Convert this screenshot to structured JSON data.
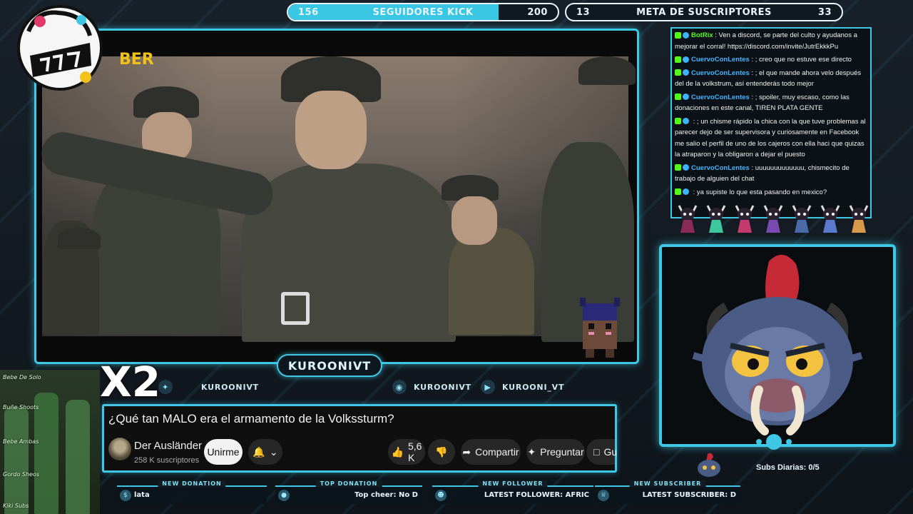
{
  "top_bars": {
    "kick": {
      "current": "156",
      "label": "SEGUIDORES KICK",
      "goal": "200",
      "progress": 0.78
    },
    "meta": {
      "current": "13",
      "label": "META DE SUSCRIPTORES",
      "goal": "33",
      "progress": 0.0
    }
  },
  "video": {
    "overlay_text": "BER",
    "channel_badge": "KUROONIVT",
    "multiplier": "X2"
  },
  "socials": [
    {
      "icon": "twitter-icon",
      "label": "KUROONIVT"
    },
    {
      "icon": "instagram-icon",
      "label": "KUROONIVT"
    },
    {
      "icon": "youtube-icon",
      "label": "KUROONI_VT"
    }
  ],
  "youtube": {
    "title": "¿Qué tan MALO era el armamento de la Volkssturm?",
    "channel": "Der Ausländer",
    "subscribers": "258 K suscriptores",
    "join_label": "Unirme",
    "like_count": "5,6 K",
    "share_label": "Compartir",
    "ask_label": "Preguntar",
    "save_label": "Gu"
  },
  "chat": [
    {
      "user": "BotRix",
      "user_color": "#53fc18",
      "text": ": Ven a discord, se parte del culto y ayudanos a mejorar el corral! https://discord.com/invite/JutrEkkkPu"
    },
    {
      "user": "CuervoConLentes",
      "user_color": "#3fb6ff",
      "text": ": ; creo que no estuve ese directo"
    },
    {
      "user": "CuervoConLentes",
      "user_color": "#3fb6ff",
      "text": ": ; el que mande ahora velo después del de la volkstrum, así entenderás todo mejor"
    },
    {
      "user": "CuervoConLentes",
      "user_color": "#3fb6ff",
      "text": ": ; spoiler, muy escaso, como las donaciones en este canal, TIREN PLATA GENTE"
    },
    {
      "user": "",
      "user_color": "#e0173f",
      "text": ": ; un chisme rápido la chica con la que tuve problemas al parecer dejo de ser supervisora y curiosamente en Facebook me salio el perfil de uno de los cajeros con ella haci que quizas la atraparon y la obligaron a dejar el puesto"
    },
    {
      "user": "CuervoConLentes",
      "user_color": "#3fb6ff",
      "text": ": uuuuuuuuuuuuu, chismecito de trabajo de alguien del chat"
    },
    {
      "user": "",
      "user_color": "#e0173f",
      "text": ": ya supiste lo que esta pasando en mexico?"
    }
  ],
  "subs_daily": {
    "label": "Subs Diarias:",
    "value": "0/5"
  },
  "alerts": [
    {
      "label": "NEW DONATION",
      "icon": "dollar-icon",
      "text": "lata"
    },
    {
      "label": "TOP DONATION",
      "icon": "bag-icon",
      "text": "Top cheer: No D"
    },
    {
      "label": "NEW FOLLOWER",
      "icon": "user-icon",
      "text": "LATEST FOLLOWER: AFRIC"
    },
    {
      "label": "NEW SUBSCRIBER",
      "icon": "crown-icon",
      "text": "LATEST SUBSCRIBER: D"
    }
  ],
  "colors": {
    "accent": "#3ec8e6",
    "kick_green": "#53fc18",
    "background": "#141b22"
  }
}
